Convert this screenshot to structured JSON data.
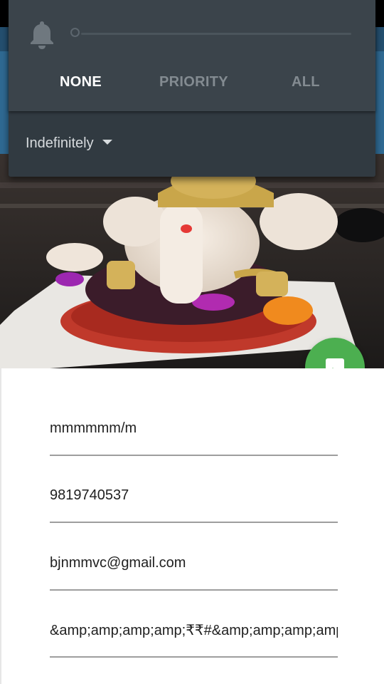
{
  "dnd_panel": {
    "tabs": [
      "NONE",
      "PRIORITY",
      "ALL"
    ],
    "selected_tab": "NONE",
    "duration": "Indefinitely",
    "icons": {
      "bell": "bell-icon",
      "dropdown": "chevron-down-icon"
    }
  },
  "fab": {
    "icon": "image-icon",
    "color": "#4caf50"
  },
  "form": {
    "fields": [
      {
        "value": "mmmmmm/m"
      },
      {
        "value": "9819740537"
      },
      {
        "value": "bjnmmvc@gmail.com"
      },
      {
        "value": "&amp;amp;amp;amp;₹₹#&amp;amp;amp;amp;amp;"
      }
    ]
  },
  "colors": {
    "panel": "#313a41",
    "appbar": "#2f6a93",
    "accent": "#4caf50"
  }
}
